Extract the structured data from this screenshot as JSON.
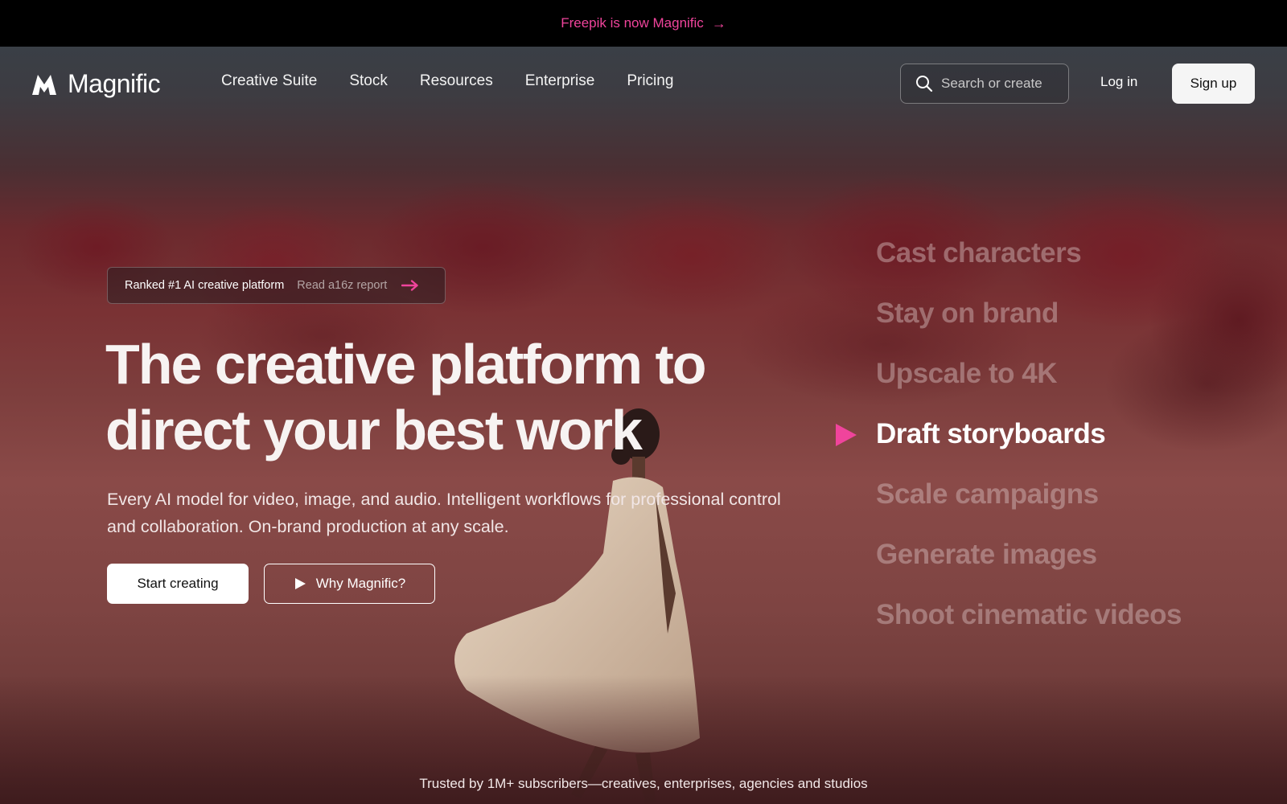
{
  "announcement": {
    "text": "Freepik is now Magnific",
    "arrow": "→"
  },
  "nav": {
    "brand": "Magnific",
    "links": [
      "Creative Suite",
      "Stock",
      "Resources",
      "Enterprise",
      "Pricing"
    ],
    "search_placeholder": "Search or create",
    "login": "Log in",
    "signup": "Sign up"
  },
  "hero": {
    "badge_primary": "Ranked #1 AI creative platform",
    "badge_link": "Read a16z report",
    "headline_line1": "The creative platform to",
    "headline_line2": "direct your best work",
    "subtitle": "Every AI model for video, image, and audio. Intelligent workflows for professional control and collaboration. On-brand production at any scale.",
    "cta_primary": "Start creating",
    "cta_secondary": "Why Magnific?"
  },
  "features": {
    "items": [
      "Cast characters",
      "Stay on brand",
      "Upscale to 4K",
      "Draft storyboards",
      "Scale campaigns",
      "Generate images",
      "Shoot cinematic videos"
    ],
    "active_index": 3
  },
  "footer_note": "Trusted by 1M+ subscribers—creatives, enterprises, agencies and studios",
  "colors": {
    "accent": "#f0449c",
    "background": "#000000",
    "button_light": "#f5f5f5"
  }
}
